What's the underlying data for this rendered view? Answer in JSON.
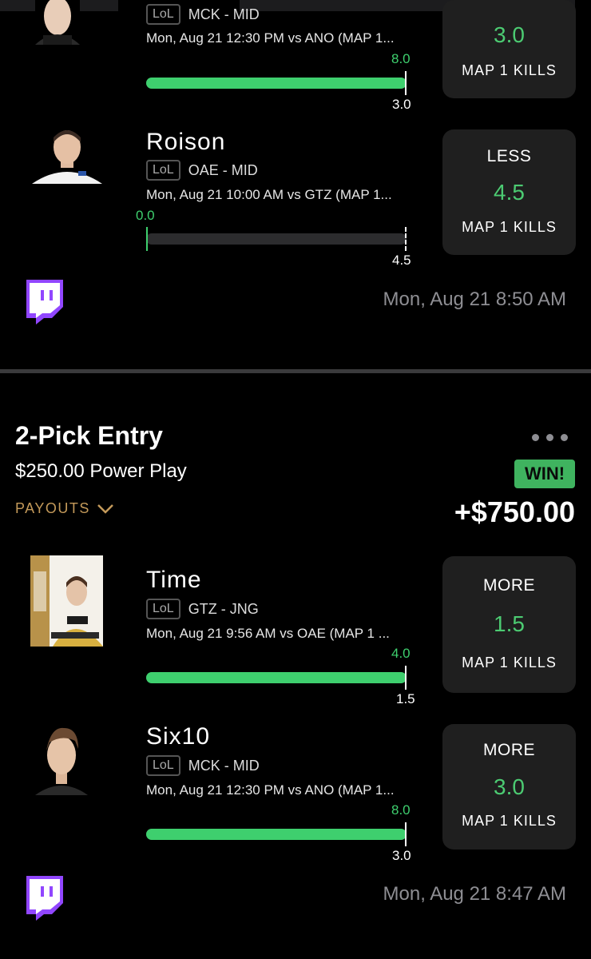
{
  "previous_entry": {
    "picks": [
      {
        "player": "",
        "game": "LoL",
        "team_pos": "MCK - MID",
        "match_info": "Mon, Aug 21 12:30 PM  vs ANO (MAP 1...",
        "actual": "8.0",
        "line": "3.0",
        "progress_fraction": 1.0,
        "direction": "",
        "card_line": "3.0",
        "stat": "MAP 1 KILLS"
      },
      {
        "player": "Roison",
        "game": "LoL",
        "team_pos": "OAE - MID",
        "match_info": "Mon, Aug 21 10:00 AM  vs GTZ (MAP 1...",
        "actual": "0.0",
        "line": "4.5",
        "progress_fraction": 0.0,
        "direction": "LESS",
        "card_line": "4.5",
        "stat": "MAP 1 KILLS"
      }
    ],
    "timestamp": "Mon, Aug 21 8:50 AM"
  },
  "entry": {
    "title": "2-Pick Entry",
    "subtitle": "$250.00 Power Play",
    "payouts_label": "PAYOUTS",
    "result_badge": "WIN!",
    "payout_amount": "+$750.00",
    "picks": [
      {
        "player": "Time",
        "game": "LoL",
        "team_pos": "GTZ - JNG",
        "match_info": "Mon, Aug 21 9:56 AM  vs OAE (MAP 1 ...",
        "actual": "4.0",
        "line": "1.5",
        "progress_fraction": 1.0,
        "direction": "MORE",
        "card_line": "1.5",
        "stat": "MAP 1 KILLS"
      },
      {
        "player": "Six10",
        "game": "LoL",
        "team_pos": "MCK - MID",
        "match_info": "Mon, Aug 21 12:30 PM  vs ANO (MAP 1...",
        "actual": "8.0",
        "line": "3.0",
        "progress_fraction": 1.0,
        "direction": "MORE",
        "card_line": "3.0",
        "stat": "MAP 1 KILLS"
      }
    ],
    "timestamp": "Mon, Aug 21 8:47 AM"
  },
  "colors": {
    "accent_green": "#3ecf6e",
    "win_badge": "#3fb35f",
    "payouts_gold": "#c49a5a",
    "card_bg": "#1f1f1f",
    "twitch_purple": "#9146ff"
  },
  "icons": {
    "twitch": "twitch-icon",
    "chevron": "chevron-down-icon",
    "more": "more-options-icon"
  }
}
